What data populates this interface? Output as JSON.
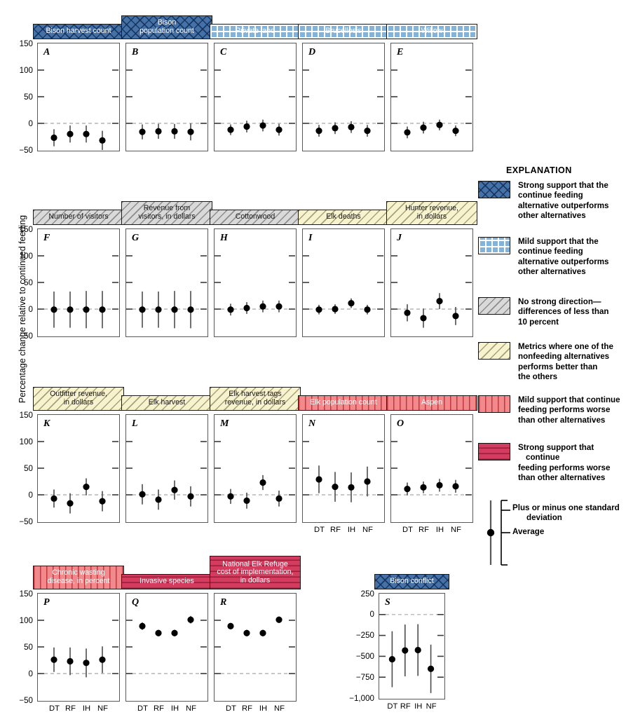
{
  "axis": {
    "ylabel": "Percentage change relative to continued feeding",
    "yticks_main": [
      "150",
      "100",
      "50",
      "0",
      "-50"
    ],
    "yticks_s": [
      "250",
      "0",
      "-250",
      "-500",
      "-750",
      "-1,000"
    ],
    "xticks": [
      "DT",
      "RF",
      "IH",
      "NF"
    ]
  },
  "explanation": {
    "title": "EXPLANATION",
    "items": [
      {
        "swatch": "strong-blue",
        "lines": [
          "Strong support that the",
          "continue feeding",
          "alternative outperforms",
          "other alternatives"
        ]
      },
      {
        "swatch": "mild-blue",
        "lines": [
          "Mild support that the",
          "continue feeding",
          "alternative outperforms",
          "other alternatives"
        ]
      },
      {
        "swatch": "gray",
        "lines": [
          "No strong direction—",
          "differences of less than",
          "10 percent"
        ]
      },
      {
        "swatch": "yellow",
        "lines": [
          "Metrics where one of the",
          "nonfeeding alternatives",
          "performs better than",
          "the others"
        ]
      },
      {
        "swatch": "mild-red",
        "lines": [
          "Mild support that continue",
          "feeding performs worse",
          "than other alternatives"
        ]
      },
      {
        "swatch": "strong-red",
        "lines": [
          "Strong support that continue",
          "feeding performs worse",
          "than other alternatives"
        ]
      }
    ],
    "errorbar_key": {
      "sd_label": [
        "Plus or minus one standard",
        "deviation"
      ],
      "mean_label": [
        "Average"
      ]
    }
  },
  "chart_data": {
    "type": "scatter",
    "title": "",
    "xlabel": "",
    "ylabel": "Percentage change relative to continued feeding",
    "categories": [
      "DT",
      "RF",
      "IH",
      "NF"
    ],
    "grid": false,
    "legend_position": "right",
    "panels": [
      {
        "letter": "A",
        "title": "Bison harvest count",
        "swatch": "strong-blue",
        "ylim": [
          -50,
          150
        ],
        "values": [
          -27,
          -20,
          -20,
          -32
        ],
        "sd": [
          16,
          16,
          16,
          18
        ]
      },
      {
        "letter": "B",
        "title": "Bison population count",
        "swatch": "strong-blue",
        "ylim": [
          -50,
          150
        ],
        "values": [
          -16,
          -15,
          -15,
          -16
        ],
        "sd": [
          14,
          14,
          14,
          16
        ]
      },
      {
        "letter": "C",
        "title": "Private land",
        "swatch": "mild-blue",
        "ylim": [
          -50,
          150
        ],
        "values": [
          -12,
          -6,
          -4,
          -12
        ],
        "sd": [
          10,
          11,
          11,
          11
        ]
      },
      {
        "letter": "D",
        "title": "Brucellosis",
        "swatch": "mild-blue",
        "ylim": [
          -50,
          150
        ],
        "values": [
          -14,
          -9,
          -7,
          -14
        ],
        "sd": [
          11,
          11,
          11,
          11
        ]
      },
      {
        "letter": "E",
        "title": "Willow",
        "swatch": "mild-blue",
        "ylim": [
          -50,
          150
        ],
        "values": [
          -17,
          -8,
          -3,
          -14
        ],
        "sd": [
          11,
          11,
          10,
          10
        ]
      },
      {
        "letter": "F",
        "title": "Number of visitors",
        "swatch": "gray",
        "ylim": [
          -50,
          150
        ],
        "values": [
          -1,
          -1,
          -1,
          -1
        ],
        "sd": [
          34,
          34,
          35,
          35
        ]
      },
      {
        "letter": "G",
        "title": "Revenue from visitors, in dollars",
        "swatch": "gray",
        "ylim": [
          -50,
          150
        ],
        "values": [
          -1,
          -1,
          -1,
          -1
        ],
        "sd": [
          34,
          34,
          35,
          35
        ]
      },
      {
        "letter": "H",
        "title": "Cottonwood",
        "swatch": "gray",
        "ylim": [
          -50,
          150
        ],
        "values": [
          -1,
          2,
          5,
          5
        ],
        "sd": [
          11,
          11,
          11,
          11
        ]
      },
      {
        "letter": "I",
        "title": "Elk deaths",
        "swatch": "yellow",
        "ylim": [
          -50,
          150
        ],
        "values": [
          -1,
          0,
          11,
          -1
        ],
        "sd": [
          9,
          9,
          9,
          9
        ]
      },
      {
        "letter": "J",
        "title": "Hunter revenue, in dollars",
        "swatch": "yellow",
        "ylim": [
          -50,
          150
        ],
        "values": [
          -7,
          -17,
          15,
          -13
        ],
        "sd": [
          16,
          18,
          15,
          17
        ]
      },
      {
        "letter": "K",
        "title": "Outfitter revenue, in dollars",
        "swatch": "yellow",
        "ylim": [
          -50,
          150
        ],
        "values": [
          -7,
          -16,
          15,
          -12
        ],
        "sd": [
          17,
          19,
          16,
          19
        ]
      },
      {
        "letter": "L",
        "title": "Elk harvest",
        "swatch": "yellow",
        "ylim": [
          -50,
          150
        ],
        "values": [
          1,
          -9,
          9,
          -3
        ],
        "sd": [
          19,
          19,
          18,
          19
        ]
      },
      {
        "letter": "M",
        "title": "Elk harvest tags revenue, in dollars",
        "swatch": "yellow",
        "ylim": [
          -50,
          150
        ],
        "values": [
          -3,
          -11,
          23,
          -7
        ],
        "sd": [
          14,
          15,
          14,
          15
        ]
      },
      {
        "letter": "N",
        "title": "Elk population count",
        "swatch": "mild-red",
        "ylim": [
          -50,
          150
        ],
        "values": [
          29,
          15,
          14,
          25
        ],
        "sd": [
          26,
          28,
          28,
          28
        ]
      },
      {
        "letter": "O",
        "title": "Aspen",
        "swatch": "mild-red",
        "ylim": [
          -50,
          150
        ],
        "values": [
          11,
          14,
          18,
          16
        ],
        "sd": [
          12,
          11,
          12,
          12
        ]
      },
      {
        "letter": "P",
        "title": "Chronic wasting disease, in percent",
        "swatch": "mild-red",
        "ylim": [
          -50,
          150
        ],
        "values": [
          26,
          23,
          20,
          26
        ],
        "sd": [
          23,
          26,
          27,
          25
        ]
      },
      {
        "letter": "Q",
        "title": "Invasive species",
        "swatch": "strong-red",
        "ylim": [
          -50,
          150
        ],
        "values": [
          89,
          76,
          76,
          101
        ],
        "sd": [
          7,
          6,
          6,
          7
        ]
      },
      {
        "letter": "R",
        "title": "National Elk Refuge cost of implementation, in dollars",
        "swatch": "strong-red",
        "ylim": [
          -50,
          150
        ],
        "values": [
          89,
          76,
          76,
          101
        ],
        "sd": [
          6,
          6,
          6,
          6
        ]
      },
      {
        "letter": "S",
        "title": "Bison conflict",
        "swatch": "strong-blue",
        "ylim": [
          -1000,
          250
        ],
        "values": [
          -535,
          -430,
          -425,
          -650
        ],
        "sd": [
          335,
          310,
          310,
          290
        ]
      }
    ]
  }
}
